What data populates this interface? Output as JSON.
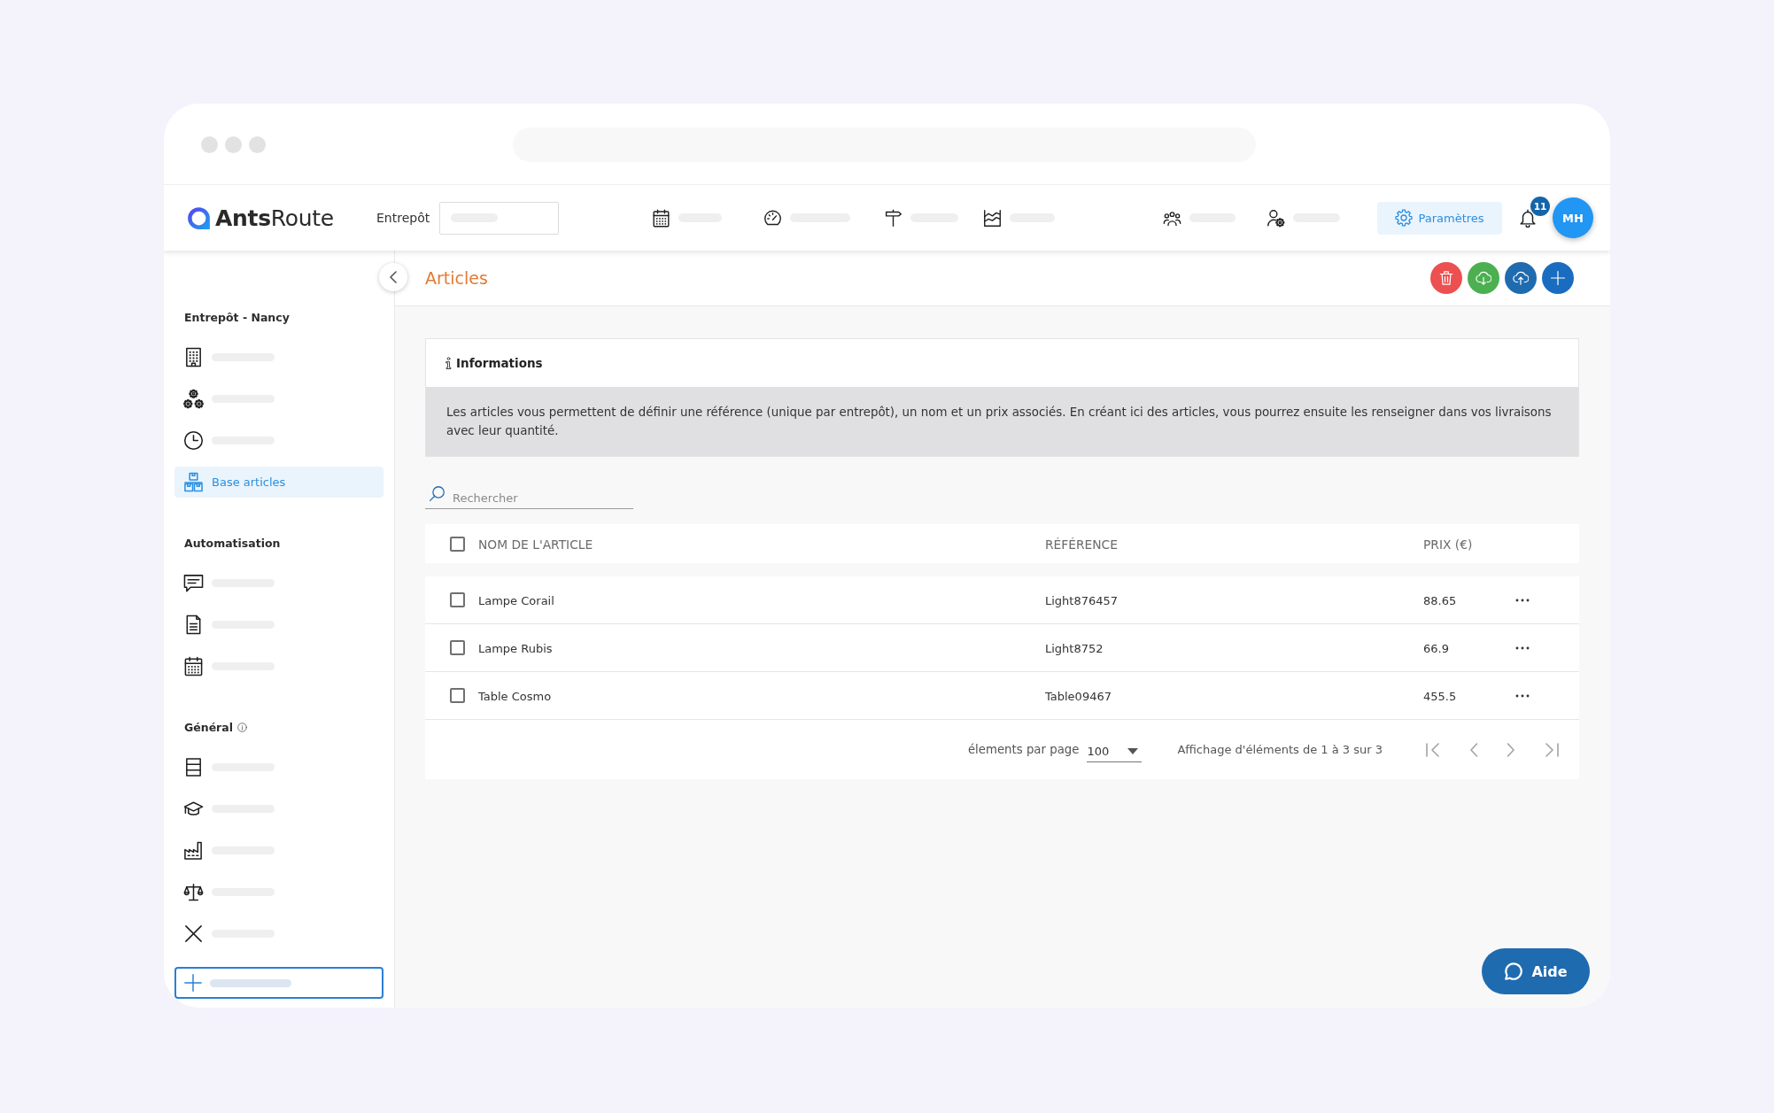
{
  "header": {
    "logo": "**Ants**Route",
    "warehouse_label": "Entrepôt",
    "settings_button": "Paramètres",
    "notification_count": "11",
    "avatar_initials": "MH"
  },
  "sidebar": {
    "sections": [
      {
        "title": "Entrepôt - Nancy",
        "info_icon": false,
        "items": [
          {
            "selected": false
          },
          {
            "selected": false
          },
          {
            "selected": false
          },
          {
            "label": "Base articles",
            "selected": true
          }
        ]
      },
      {
        "title": "Automatisation",
        "info_icon": false,
        "items": [
          {
            "selected": false
          },
          {
            "selected": false
          },
          {
            "selected": false
          }
        ]
      },
      {
        "title": "Général",
        "info_icon": true,
        "items": [
          {
            "selected": false
          },
          {
            "selected": false
          },
          {
            "selected": false
          },
          {
            "selected": false
          },
          {
            "selected": false
          }
        ]
      }
    ]
  },
  "page": {
    "title": "Articles",
    "actions": [
      {
        "kind": "delete"
      },
      {
        "kind": "download"
      },
      {
        "kind": "upload"
      },
      {
        "kind": "add"
      }
    ]
  },
  "info_card": {
    "title": "Informations",
    "text": "Les articles vous permettent de définir une référence (unique par entrepôt), un nom et un prix associés. En créant ici des articles, vous pourrez ensuite les renseigner dans vos livraisons avec leur quantité."
  },
  "search": {
    "placeholder": "Rechercher"
  },
  "table": {
    "select_all_checked": false,
    "columns": [
      "NOM DE L'ARTICLE",
      "RÉFÉRENCE",
      "PRIX (€)"
    ],
    "rows": [
      {
        "name": "Lampe Corail",
        "reference": "Light876457",
        "price": "88.65",
        "checked": false
      },
      {
        "name": "Lampe Rubis",
        "reference": "Light8752",
        "price": "66.9",
        "checked": false
      },
      {
        "name": "Table Cosmo",
        "reference": "Table09467",
        "price": "455.5",
        "checked": false
      }
    ]
  },
  "pagination": {
    "per_page_label": "élements par page",
    "per_page": "100",
    "summary": "Affichage d'éléments de 1 à 3 sur 3",
    "buttons": [
      {
        "kind": "first",
        "disabled": true
      },
      {
        "kind": "previous",
        "disabled": true
      },
      {
        "kind": "next",
        "disabled": true
      },
      {
        "kind": "last",
        "disabled": true
      }
    ]
  },
  "help_button": {
    "label": "Aide"
  }
}
